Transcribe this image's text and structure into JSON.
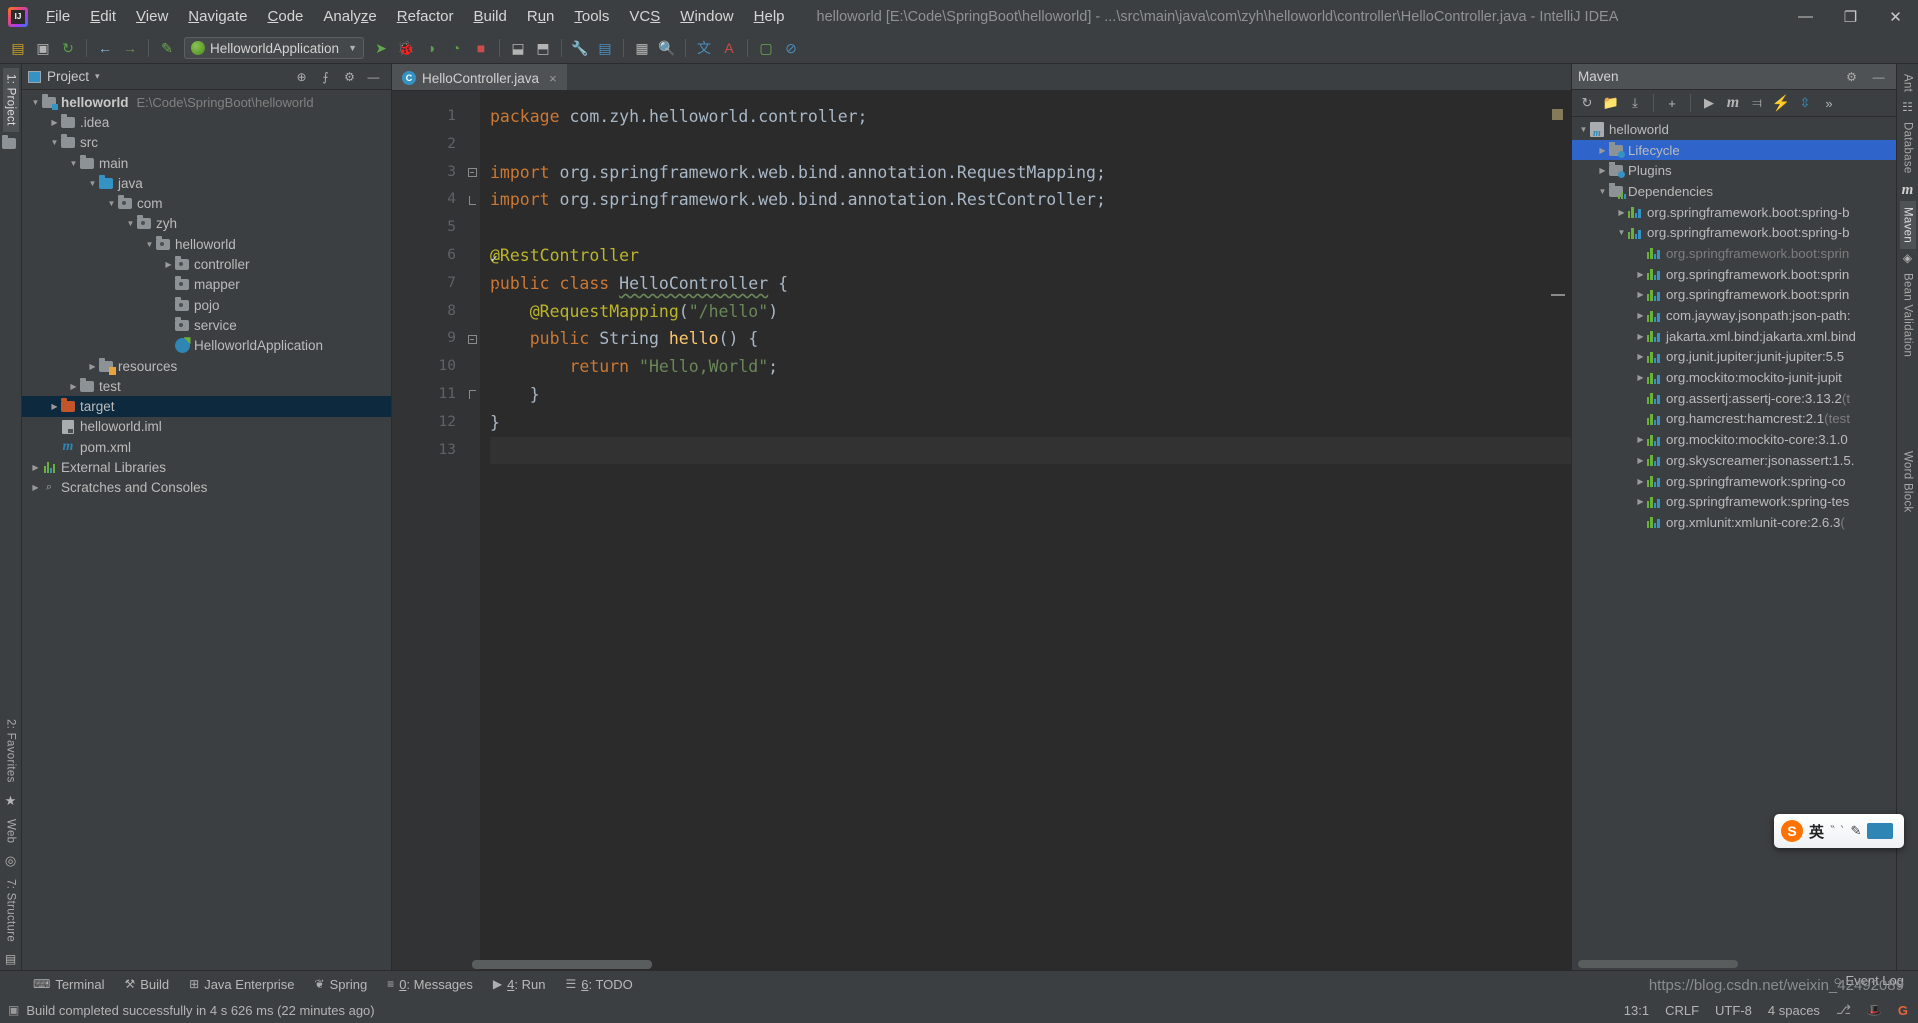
{
  "window": {
    "title": "helloworld [E:\\Code\\SpringBoot\\helloworld] - ...\\src\\main\\java\\com\\zyh\\helloworld\\controller\\HelloController.java - IntelliJ IDEA",
    "minimize": "—",
    "maximize": "❐",
    "close": "✕",
    "logo": "intellij-idea-logo"
  },
  "menubar": [
    {
      "label": "File"
    },
    {
      "label": "Edit"
    },
    {
      "label": "View"
    },
    {
      "label": "Navigate"
    },
    {
      "label": "Code"
    },
    {
      "label": "Analyze"
    },
    {
      "label": "Refactor"
    },
    {
      "label": "Build"
    },
    {
      "label": "Run"
    },
    {
      "label": "Tools"
    },
    {
      "label": "VCS"
    },
    {
      "label": "Window"
    },
    {
      "label": "Help"
    }
  ],
  "toolbar": {
    "open_icon": "📁",
    "save_icon": "💾",
    "sync_icon": "↻",
    "back_icon": "←",
    "forward_icon": "→",
    "make_icon": "✒",
    "run_config": "HelloworldApplication",
    "run_icon": "▶",
    "debug_icon": "🐞",
    "coverage_icon": "◑",
    "profile_icon": "◴",
    "stop_icon": "■",
    "update_icon": "⤓",
    "commit_icon": "⤒",
    "settings_icon": "🔧",
    "struct_icon": "☰",
    "find_icon": "🔍",
    "search_icon": "🔎",
    "translate1_icon": "文A",
    "translate2_icon": "A文",
    "lang_icon": "⚙",
    "block_icon": "⊘"
  },
  "left_stripe": {
    "project_tab": "1: Project",
    "favorites_tab": "2: Favorites",
    "web_tab": "Web",
    "structure_tab": "7: Structure",
    "project_icon": "project-folder-icon",
    "star_icon": "★",
    "web_icon": "◎",
    "bottom_icon": "▤"
  },
  "project_panel": {
    "title": "Project",
    "caret": "▾",
    "locate_icon": "⊕",
    "collapse_icon": "⨍",
    "settings_icon": "⚙",
    "hide_icon": "—",
    "tree": [
      {
        "label": "helloworld",
        "path": "E:\\Code\\SpringBoot\\helloworld",
        "indent": 0,
        "arrow": "down",
        "icon": "module",
        "bold": true
      },
      {
        "label": ".idea",
        "indent": 1,
        "arrow": "right",
        "icon": "folder"
      },
      {
        "label": "src",
        "indent": 1,
        "arrow": "down",
        "icon": "folder"
      },
      {
        "label": "main",
        "indent": 2,
        "arrow": "down",
        "icon": "folder"
      },
      {
        "label": "java",
        "indent": 3,
        "arrow": "down",
        "icon": "source"
      },
      {
        "label": "com",
        "indent": 4,
        "arrow": "down",
        "icon": "package"
      },
      {
        "label": "zyh",
        "indent": 5,
        "arrow": "down",
        "icon": "package"
      },
      {
        "label": "helloworld",
        "indent": 6,
        "arrow": "down",
        "icon": "package"
      },
      {
        "label": "controller",
        "indent": 7,
        "arrow": "right",
        "icon": "package"
      },
      {
        "label": "mapper",
        "indent": 7,
        "arrow": "none",
        "icon": "package"
      },
      {
        "label": "pojo",
        "indent": 7,
        "arrow": "none",
        "icon": "package"
      },
      {
        "label": "service",
        "indent": 7,
        "arrow": "none",
        "icon": "package"
      },
      {
        "label": "HelloworldApplication",
        "indent": 7,
        "arrow": "none",
        "icon": "springclass"
      },
      {
        "label": "resources",
        "indent": 3,
        "arrow": "right",
        "icon": "resources"
      },
      {
        "label": "test",
        "indent": 2,
        "arrow": "right",
        "icon": "folder"
      },
      {
        "label": "target",
        "indent": 1,
        "arrow": "right",
        "icon": "target",
        "selected": true
      },
      {
        "label": "helloworld.iml",
        "indent": 1,
        "arrow": "none",
        "icon": "iml"
      },
      {
        "label": "pom.xml",
        "indent": 1,
        "arrow": "none",
        "icon": "maven"
      },
      {
        "label": "External Libraries",
        "indent": 0,
        "arrow": "right",
        "icon": "library"
      },
      {
        "label": "Scratches and Consoles",
        "indent": 0,
        "arrow": "right",
        "icon": "scratch"
      }
    ]
  },
  "editor": {
    "tab": {
      "label": "HelloController.java",
      "icon_letter": "C",
      "close": "×"
    },
    "lines": [
      {
        "n": "1",
        "html": "<span class=\"k\">package</span> com.zyh.helloworld.controller;"
      },
      {
        "n": "2",
        "html": ""
      },
      {
        "n": "3",
        "html": "<span class=\"k\">import</span> org.springframework.web.bind.annotation.RequestMapping;",
        "fold": "minus"
      },
      {
        "n": "4",
        "html": "<span class=\"k\">import</span> org.springframework.web.bind.annotation.RestController;",
        "fold": "end"
      },
      {
        "n": "5",
        "html": ""
      },
      {
        "n": "6",
        "html": "<span class=\"an\">@RestController</span>",
        "gmark": "spring-bean"
      },
      {
        "n": "7",
        "html": "<span class=\"k\">public class</span> <span class=\"cls-u\">HelloController</span> {",
        "gmark": "spring-class"
      },
      {
        "n": "8",
        "html": "    <span class=\"an\">@RequestMapping</span>(<span class=\"s\">\"/hello\"</span>)"
      },
      {
        "n": "9",
        "html": "    <span class=\"k\">public</span> String <span class=\"ty\">hello</span>() {",
        "fold": "minus"
      },
      {
        "n": "10",
        "html": "        <span class=\"k\">return</span> <span class=\"s\">\"Hello,World\"</span>;"
      },
      {
        "n": "11",
        "html": "    }",
        "fold": "endup"
      },
      {
        "n": "12",
        "html": "}"
      },
      {
        "n": "13",
        "html": "",
        "current": true
      }
    ]
  },
  "maven_panel": {
    "title": "Maven",
    "settings_icon": "⚙",
    "hide_icon": "—",
    "tools": {
      "reload_icon": "↻",
      "add_dir_icon": "📁",
      "download_icon": "⤓",
      "plus_icon": "+",
      "run_icon": "▶",
      "maven_icon": "m",
      "skip_tests_icon": "⫤",
      "execute_icon": "⚡",
      "expand_icon": "⇳",
      "more_icon": "»"
    },
    "tree": [
      {
        "label": "helloworld",
        "indent": 0,
        "arrow": "down",
        "icon": "mvnproject"
      },
      {
        "label": "Lifecycle",
        "indent": 1,
        "arrow": "right",
        "icon": "phase",
        "selected": true
      },
      {
        "label": "Plugins",
        "indent": 1,
        "arrow": "right",
        "icon": "phase"
      },
      {
        "label": "Dependencies",
        "indent": 1,
        "arrow": "down",
        "icon": "depfolder"
      },
      {
        "label": "org.springframework.boot:spring-b",
        "indent": 2,
        "arrow": "right",
        "icon": "dep"
      },
      {
        "label": "org.springframework.boot:spring-b",
        "indent": 2,
        "arrow": "down",
        "icon": "dep"
      },
      {
        "label": "org.springframework.boot:sprin",
        "indent": 3,
        "arrow": "none",
        "icon": "dep",
        "dim": true
      },
      {
        "label": "org.springframework.boot:sprin",
        "indent": 3,
        "arrow": "right",
        "icon": "dep"
      },
      {
        "label": "org.springframework.boot:sprin",
        "indent": 3,
        "arrow": "right",
        "icon": "dep"
      },
      {
        "label": "com.jayway.jsonpath:json-path:",
        "indent": 3,
        "arrow": "right",
        "icon": "dep"
      },
      {
        "label": "jakarta.xml.bind:jakarta.xml.bind",
        "indent": 3,
        "arrow": "right",
        "icon": "dep"
      },
      {
        "label": "org.junit.jupiter:junit-jupiter:5.5",
        "indent": 3,
        "arrow": "right",
        "icon": "dep"
      },
      {
        "label": "org.mockito:mockito-junit-jupit",
        "indent": 3,
        "arrow": "right",
        "icon": "dep"
      },
      {
        "label": "org.assertj:assertj-core:3.13.2 ",
        "scope": "(t",
        "indent": 3,
        "arrow": "none",
        "icon": "dep"
      },
      {
        "label": "org.hamcrest:hamcrest:2.1 ",
        "scope": "(test",
        "indent": 3,
        "arrow": "none",
        "icon": "dep"
      },
      {
        "label": "org.mockito:mockito-core:3.1.0",
        "indent": 3,
        "arrow": "right",
        "icon": "dep"
      },
      {
        "label": "org.skyscreamer:jsonassert:1.5.",
        "indent": 3,
        "arrow": "right",
        "icon": "dep"
      },
      {
        "label": "org.springframework:spring-co",
        "indent": 3,
        "arrow": "right",
        "icon": "dep"
      },
      {
        "label": "org.springframework:spring-tes",
        "indent": 3,
        "arrow": "right",
        "icon": "dep"
      },
      {
        "label": "org.xmlunit:xmlunit-core:2.6.3 ",
        "scope": "(",
        "indent": 3,
        "arrow": "none",
        "icon": "dep"
      }
    ]
  },
  "right_stripe": {
    "ant_tab": "Ant",
    "database_tab": "Database",
    "maven_tab": "Maven",
    "bean_tab": "Bean Validation",
    "word_tab": "Word Block",
    "database_icon": "☷",
    "maven_icon": "m",
    "bean_icon": "◈"
  },
  "bottom_bar": [
    {
      "label": "Terminal",
      "icon": "⌨",
      "mnemonic": ""
    },
    {
      "label": "Build",
      "icon": "⚒",
      "mnemonic": ""
    },
    {
      "label": "Java Enterprise",
      "icon": "⊞",
      "mnemonic": ""
    },
    {
      "label": "Spring",
      "icon": "❦",
      "mnemonic": ""
    },
    {
      "label": "Messages",
      "icon": "≡",
      "mnemonic": "0"
    },
    {
      "label": "Run",
      "icon": "▶",
      "mnemonic": "4"
    },
    {
      "label": "TODO",
      "icon": "☰",
      "mnemonic": "6"
    }
  ],
  "statusbar": {
    "message": "Build completed successfully in 4 s 626 ms (22 minutes ago)",
    "message_icon": "▣",
    "caret_position": "13:1",
    "line_separator": "CRLF",
    "encoding": "UTF-8",
    "indent": "4 spaces",
    "branch_icon": "⎇",
    "hat_icon": "🎩",
    "google_icon": "G",
    "event_log": "Event Log",
    "event_log_icon": "○",
    "watermark": "https://blog.csdn.net/weixin_42492089"
  },
  "ime": {
    "logo": "S",
    "mode": "英",
    "dots": "‶ ‵",
    "keyboard_icon": "keyboard-icon",
    "pen_icon": "pen-icon"
  },
  "colors": {
    "accent": "#3592c4",
    "selection": "#2f65ca",
    "tree_selection": "#0d293e",
    "bg_panel": "#3c3f41",
    "bg_editor": "#2b2b2b"
  }
}
